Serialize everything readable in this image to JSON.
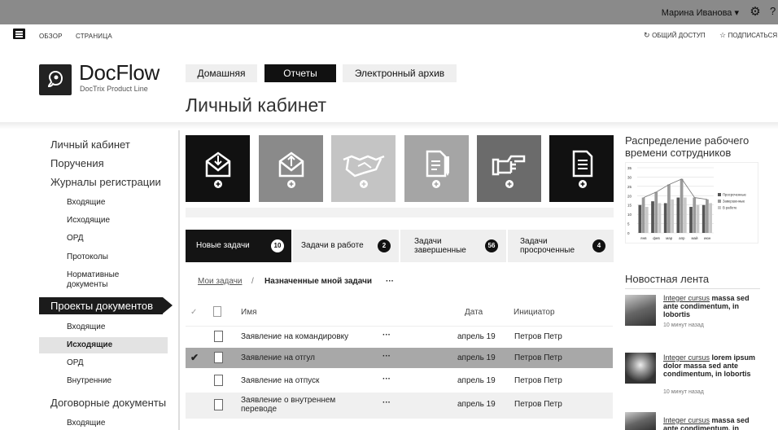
{
  "topbar": {
    "user": "Марина Иванова ▾",
    "gear_icon": "gear-icon",
    "help_icon": "help-icon"
  },
  "ribbon": {
    "tabs": [
      "ОБЗОР",
      "СТРАНИЦА"
    ],
    "share": "ОБЩИЙ ДОСТУП",
    "follow": "ПОДПИСАТЬСЯ"
  },
  "logo": {
    "title": "DocFlow",
    "subtitle": "DocTrix Product Line"
  },
  "nav_tabs": [
    {
      "label": "Домашняя",
      "active": false
    },
    {
      "label": "Отчеты",
      "active": true
    },
    {
      "label": "Электронный архив",
      "active": false
    }
  ],
  "page_title": "Личный кабинет",
  "left_nav": {
    "items": [
      "Личный кабинет",
      "Поручения",
      "Журналы регистрации",
      "Входящие",
      "Исходящие",
      "ОРД",
      "Протоколы",
      "Нормативные документы",
      "Проекты документов",
      "Входящие",
      "Исходящие",
      "ОРД",
      "Внутренние",
      "Договорные документы",
      "Входящие"
    ]
  },
  "tiles": [
    {
      "icon": "incoming-mail-icon",
      "shade": "#111111"
    },
    {
      "icon": "outgoing-mail-icon",
      "shade": "#8a8a8a"
    },
    {
      "icon": "handshake-icon",
      "shade": "#c4c4c4"
    },
    {
      "icon": "document-edit-icon",
      "shade": "#a5a5a5"
    },
    {
      "icon": "pointing-hand-icon",
      "shade": "#6b6b6b"
    },
    {
      "icon": "document-icon",
      "shade": "#111111"
    }
  ],
  "task_cards": [
    {
      "label": "Новые задачи",
      "count": "10"
    },
    {
      "label": "Задачи в работе",
      "count": "2"
    },
    {
      "label": "Задачи завершенные",
      "count": "56"
    },
    {
      "label": "Задачи просроченные",
      "count": "4"
    }
  ],
  "breadcrumb": {
    "my_tasks": "Мои задачи",
    "sep": "/",
    "assigned": "Назначенные мной задачи",
    "more": "···"
  },
  "table": {
    "headers": {
      "check": "✓",
      "name": "Имя",
      "date": "Дата",
      "initiator": "Инициатор"
    },
    "rows": [
      {
        "name": "Заявление на командировку",
        "more": "···",
        "date": "апрель 19",
        "initiator": "Петров Петр",
        "selected": false
      },
      {
        "name": "Заявление на отгул",
        "more": "···",
        "date": "апрель 19",
        "initiator": "Петров Петр",
        "selected": true
      },
      {
        "name": "Заявление на отпуск",
        "more": "···",
        "date": "апрель 19",
        "initiator": "Петров Петр",
        "selected": false
      },
      {
        "name": "Заявление о внутреннем переводе",
        "more": "···",
        "date": "апрель 19",
        "initiator": "Петров Петр",
        "selected": false
      }
    ]
  },
  "chart_title": "Распределение рабочего времени сотрудников",
  "chart_data": {
    "type": "bar",
    "categories": [
      "янв",
      "фев",
      "мар",
      "апр",
      "май",
      "июн"
    ],
    "series": [
      {
        "name": "Просроченные",
        "values": [
          15,
          17,
          16,
          19,
          14,
          15
        ]
      },
      {
        "name": "Завершенные",
        "values": [
          19,
          22,
          26,
          29,
          19,
          18
        ]
      },
      {
        "name": "В работе",
        "values": [
          14,
          16,
          18,
          19,
          15,
          16
        ]
      }
    ],
    "yticks": [
      "35",
      "30",
      "25",
      "20",
      "15",
      "10",
      "5",
      "0"
    ],
    "ylim": [
      0,
      35
    ],
    "legend": "right"
  },
  "news": {
    "title": "Новостная лента",
    "items": [
      {
        "link": "Integer cursus",
        "text": " massa sed ante condimentum, in lobortis",
        "time": "10 минут назад"
      },
      {
        "link": "Integer cursus",
        "text": " lorem ipsum dolor massa sed ante condimentum, in lobortis",
        "time": "10 минут назад"
      },
      {
        "link": "Integer cursus",
        "text": " massa sed ante condimentum, in",
        "time": ""
      }
    ]
  }
}
